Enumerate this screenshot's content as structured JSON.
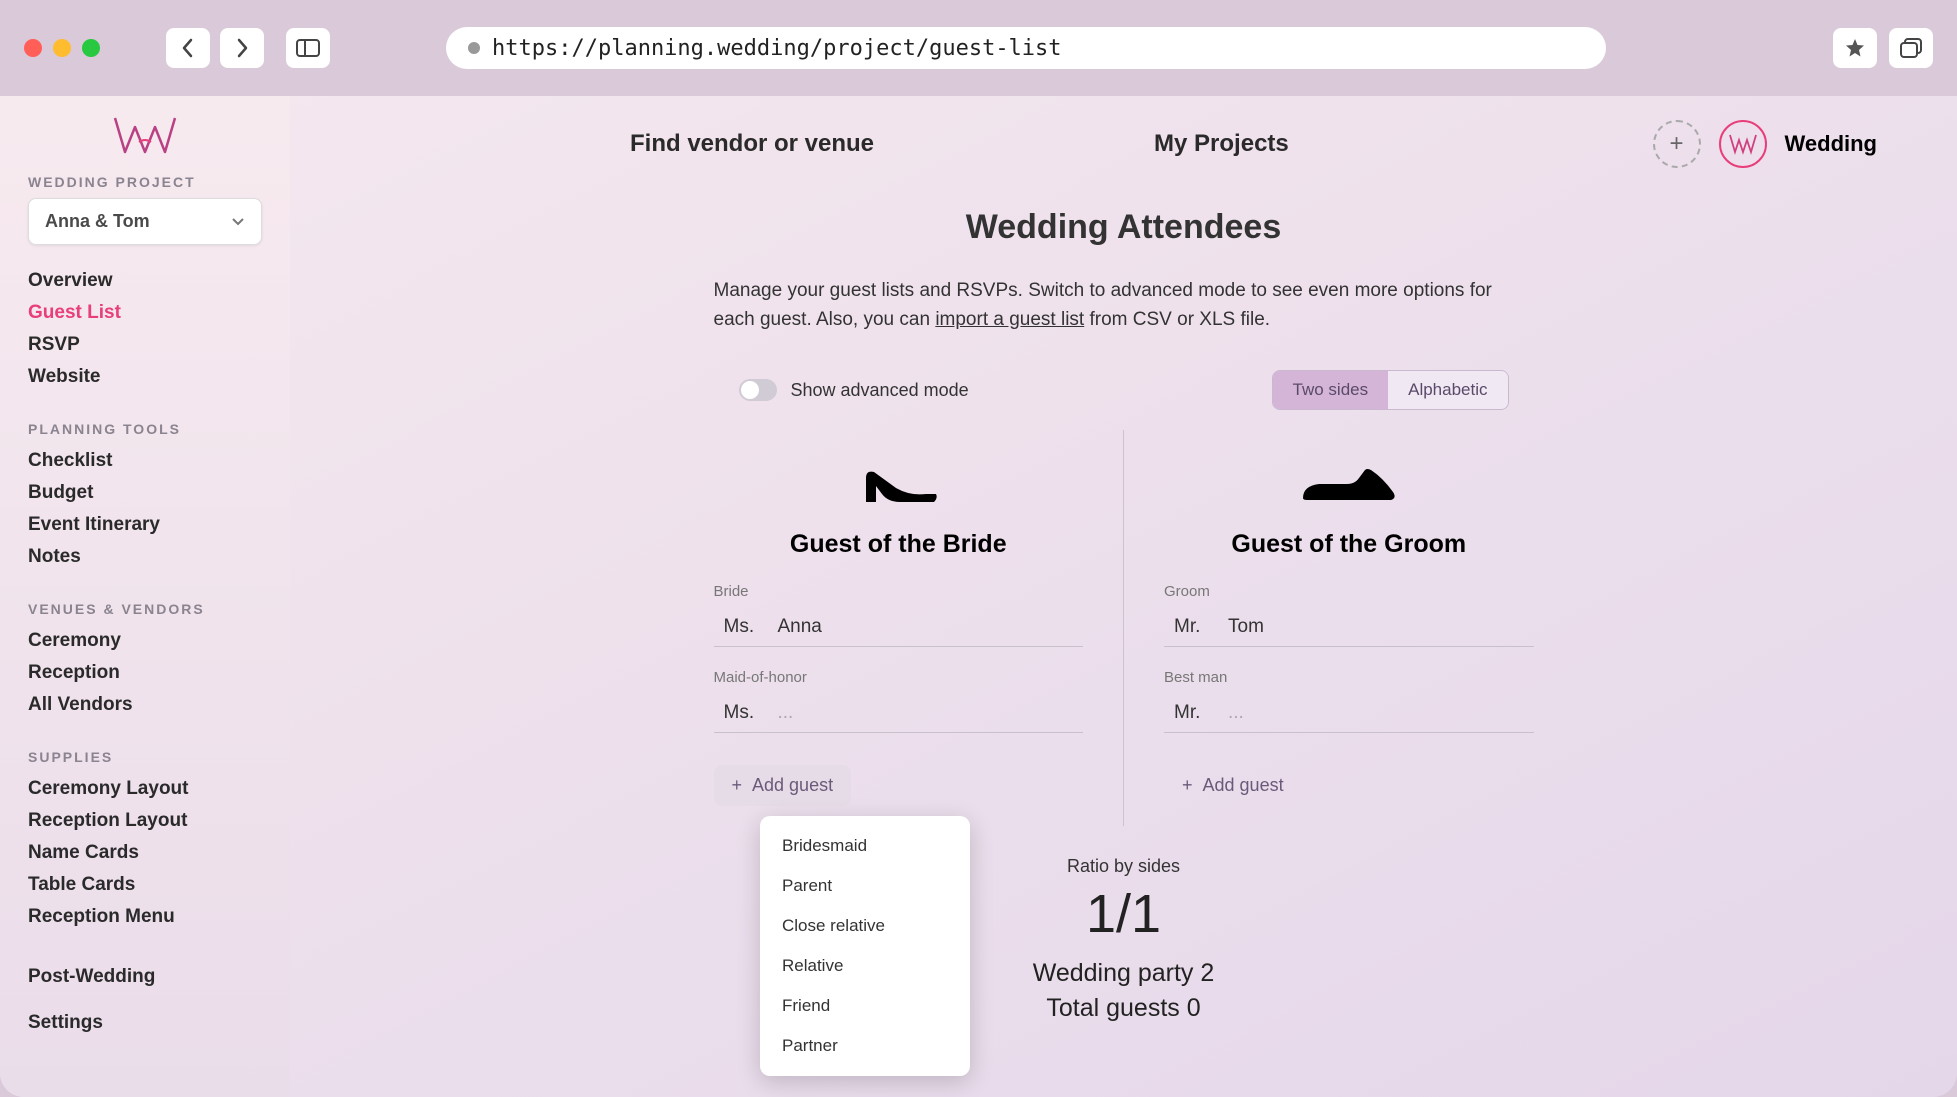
{
  "url": "https://planning.wedding/project/guest-list",
  "header": {
    "find_vendor": "Find vendor or venue",
    "my_projects": "My Projects",
    "current_project": "Wedding",
    "badge": "WA"
  },
  "sidebar": {
    "section": "WEDDING PROJECT",
    "project_name": "Anna & Tom",
    "nav_main": [
      "Overview",
      "Guest List",
      "RSVP",
      "Website"
    ],
    "nav_main_active": 1,
    "tools_label": "PLANNING TOOLS",
    "nav_tools": [
      "Checklist",
      "Budget",
      "Event Itinerary",
      "Notes"
    ],
    "venues_label": "VENUES & VENDORS",
    "nav_venues": [
      "Ceremony",
      "Reception",
      "All Vendors"
    ],
    "supplies_label": "SUPPLIES",
    "nav_supplies": [
      "Ceremony Layout",
      "Reception Layout",
      "Name Cards",
      "Table Cards",
      "Reception Menu"
    ],
    "nav_bottom": [
      "Post-Wedding",
      "Settings"
    ]
  },
  "page": {
    "title": "Wedding Attendees",
    "desc_pre": "Manage your guest lists and RSVPs. Switch to advanced mode to see even more options for each guest. Also, you can ",
    "desc_link": "import a guest list",
    "desc_post": " from CSV or XLS file.",
    "advanced_toggle": "Show advanced mode",
    "seg_two_sides": "Two sides",
    "seg_alpha": "Alphabetic"
  },
  "bride_side": {
    "title": "Guest of the Bride",
    "role1": "Bride",
    "prefix1": "Ms.",
    "name1": "Anna",
    "role2": "Maid-of-honor",
    "prefix2": "Ms.",
    "name2": "...",
    "add": "Add guest"
  },
  "groom_side": {
    "title": "Guest of the Groom",
    "role1": "Groom",
    "prefix1": "Mr.",
    "name1": "Tom",
    "role2": "Best man",
    "prefix2": "Mr.",
    "name2": "...",
    "add": "Add guest"
  },
  "dropdown": [
    "Bridesmaid",
    "Parent",
    "Close relative",
    "Relative",
    "Friend",
    "Partner"
  ],
  "stats": {
    "ratio_label": "Ratio by sides",
    "ratio": "1/1",
    "party_label": "Wedding party",
    "party_count": "2",
    "total_label": "Total guests",
    "total_count": "0"
  }
}
